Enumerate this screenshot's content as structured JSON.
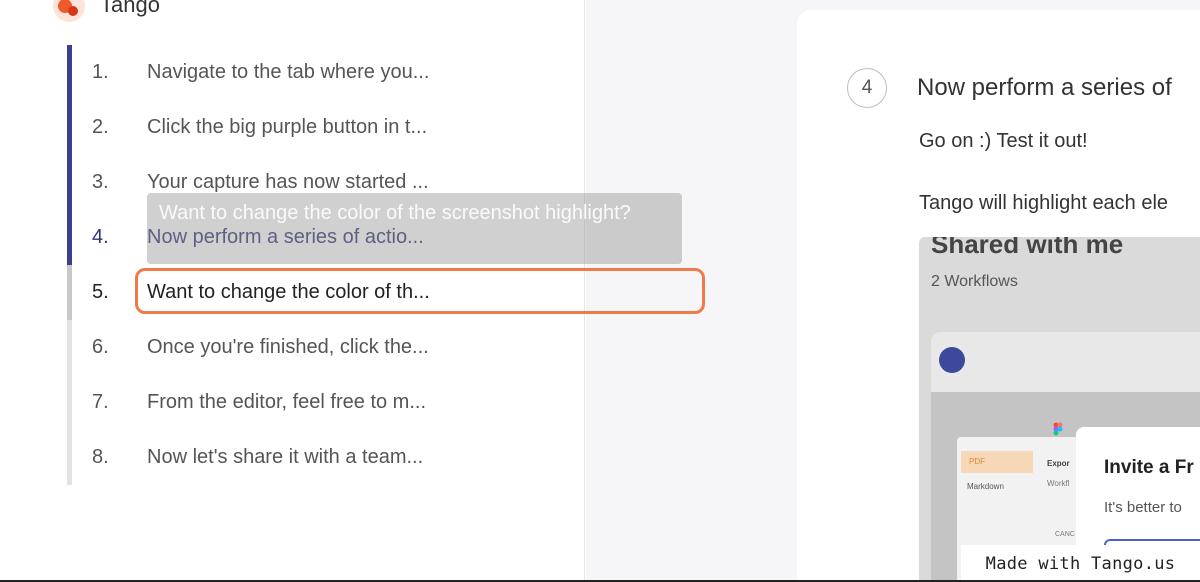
{
  "brand": {
    "name": "Tango",
    "logo_icon": "tango-logo-icon",
    "accent": "#ef5a2a"
  },
  "steps": [
    {
      "num": "1.",
      "text": "Navigate to the tab where you..."
    },
    {
      "num": "2.",
      "text": "Click the big purple button in t..."
    },
    {
      "num": "3.",
      "text": "Your capture has now started ..."
    },
    {
      "num": "4.",
      "text": "Now perform a series of actio..."
    },
    {
      "num": "5.",
      "text": "Want to change the color of th..."
    },
    {
      "num": "6.",
      "text": "Once you're finished, click the..."
    },
    {
      "num": "7.",
      "text": "From the editor, feel free to m..."
    },
    {
      "num": "8.",
      "text": "Now let's share it with a team..."
    }
  ],
  "tooltip": {
    "text": "Want to change the color of the screenshot highlight?"
  },
  "detail": {
    "step_number": "4",
    "title": "Now perform a series of",
    "paragraph1": "Go on :) Test it out!",
    "paragraph2": "Tango will highlight each ele"
  },
  "screenshot": {
    "title": "Shared with me",
    "subtitle": "2 Workflows",
    "menu_selected": "PDF",
    "menu_item": "Markdown",
    "export_label": "Expor",
    "workflow_label": "Workfl",
    "cancel_label": "CANC",
    "modal_title": "Invite a Fr",
    "modal_sub": "It's better to"
  },
  "footer": {
    "made_with": "Made with Tango.us"
  },
  "colors": {
    "progress": "#3a3f8f",
    "highlight": "#ef7b4a",
    "active_text": "#2f3474"
  }
}
